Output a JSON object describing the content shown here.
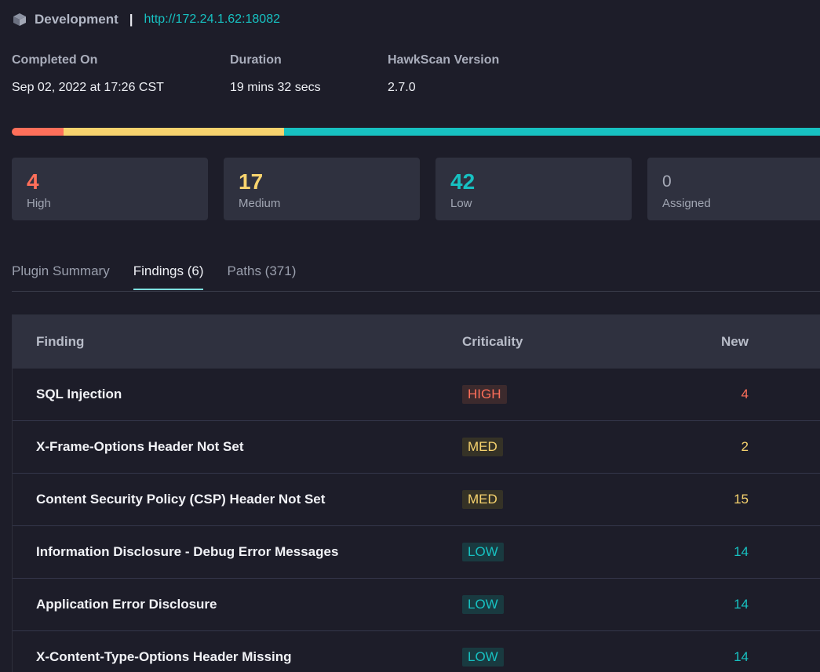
{
  "colors": {
    "high": "#fe6f5a",
    "medium": "#f7d36e",
    "low": "#17c1c1",
    "high_badge_bg": "#3c2a2d",
    "medium_badge_bg": "#353226",
    "low_badge_bg": "#193a40"
  },
  "header": {
    "env_icon": "cube-icon",
    "environment": "Development",
    "separator": "|",
    "url": "http://172.24.1.62:18082"
  },
  "meta": {
    "completed": {
      "label": "Completed On",
      "value": "Sep 02, 2022 at 17:26 CST"
    },
    "duration": {
      "label": "Duration",
      "value": "19 mins 32 secs"
    },
    "version": {
      "label": "HawkScan Version",
      "value": "2.7.0"
    }
  },
  "severity_bar": {
    "high": 4,
    "medium": 17,
    "low": 42
  },
  "stats": {
    "high": {
      "count": "4",
      "label": "High"
    },
    "medium": {
      "count": "17",
      "label": "Medium"
    },
    "low": {
      "count": "42",
      "label": "Low"
    },
    "assigned": {
      "count": "0",
      "label": "Assigned"
    }
  },
  "tabs": [
    {
      "label": "Plugin Summary",
      "active": false
    },
    {
      "label": "Findings (6)",
      "active": true
    },
    {
      "label": "Paths (371)",
      "active": false
    }
  ],
  "table": {
    "headers": {
      "finding": "Finding",
      "criticality": "Criticality",
      "new": "New"
    },
    "rows": [
      {
        "finding": "SQL Injection",
        "criticality": "HIGH",
        "level": "high",
        "new": "4"
      },
      {
        "finding": "X-Frame-Options Header Not Set",
        "criticality": "MED",
        "level": "medium",
        "new": "2"
      },
      {
        "finding": "Content Security Policy (CSP) Header Not Set",
        "criticality": "MED",
        "level": "medium",
        "new": "15"
      },
      {
        "finding": "Information Disclosure - Debug Error Messages",
        "criticality": "LOW",
        "level": "low",
        "new": "14"
      },
      {
        "finding": "Application Error Disclosure",
        "criticality": "LOW",
        "level": "low",
        "new": "14"
      },
      {
        "finding": "X-Content-Type-Options Header Missing",
        "criticality": "LOW",
        "level": "low",
        "new": "14"
      }
    ]
  }
}
